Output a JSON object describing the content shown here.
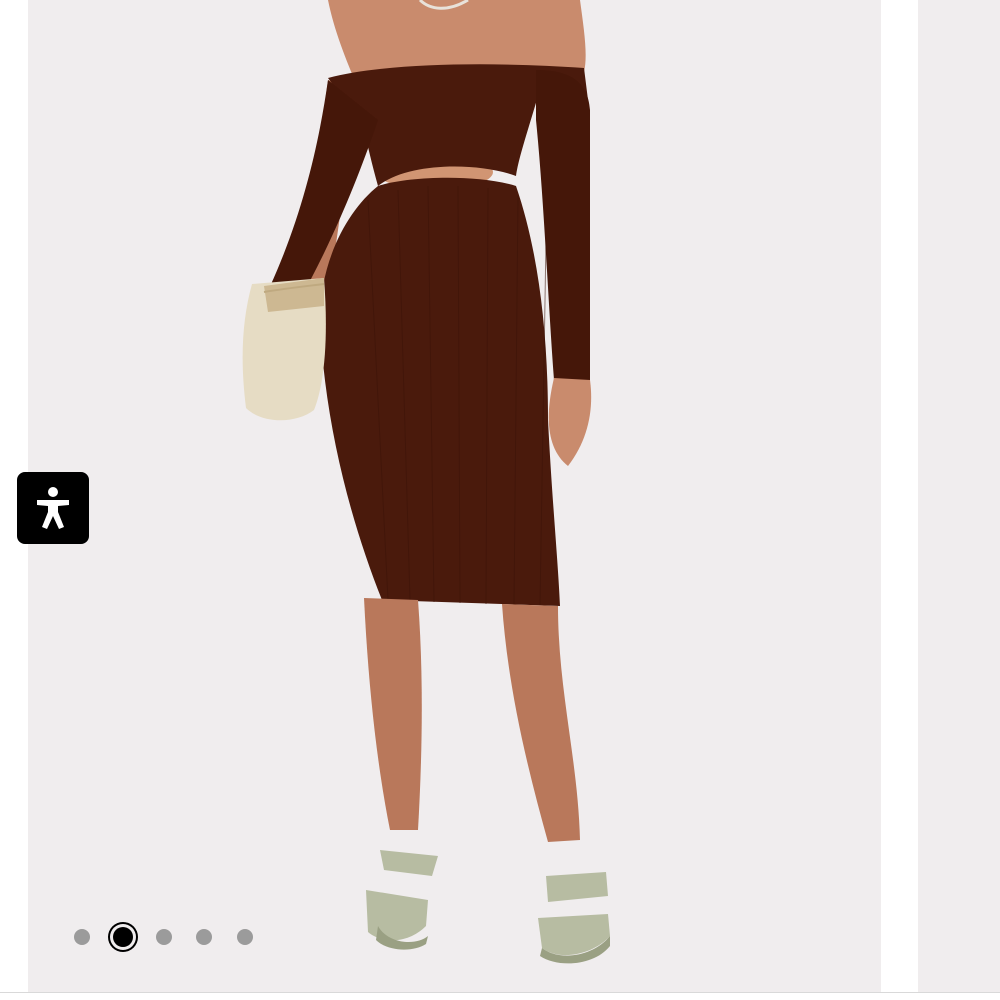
{
  "gallery": {
    "slide_count": 5,
    "active_index": 1,
    "product_image_alt": "",
    "background_color": "#f0edee",
    "dress_color": "#4a1a0c",
    "dot_color": "#9b9b9b",
    "dot_active_color": "#000000"
  },
  "accessibility": {
    "icon": "accessibility-person-icon",
    "button_color": "#000000"
  }
}
